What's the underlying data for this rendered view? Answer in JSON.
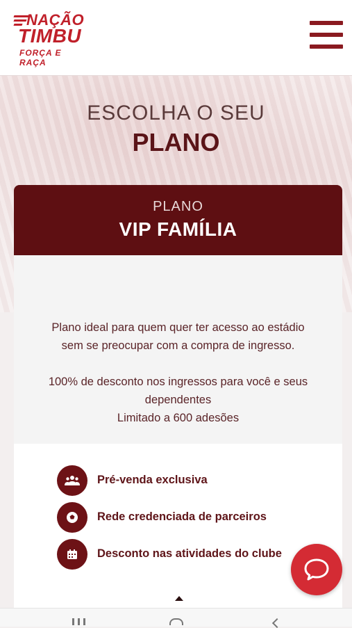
{
  "header": {
    "logo": {
      "line1": "NAÇÃO",
      "line2": "TIMBU",
      "tagline": "FORÇA E RAÇA"
    },
    "menu_icon": "hamburger-icon"
  },
  "hero": {
    "choose_label": "ESCOLHA O SEU",
    "choose_strong": "PLANO"
  },
  "plan": {
    "kicker": "PLANO",
    "name": "VIP FAMÍLIA",
    "description_line1": "Plano ideal para quem quer ter acesso ao estádio",
    "description_line2": "sem se preocupar com a compra de ingresso.",
    "discount_line1": "100% de desconto nos ingressos para você e seus",
    "discount_line2": "dependentes",
    "limit": "Limitado a 600 adesões",
    "benefits": [
      {
        "icon": "group-icon",
        "label": "Pré-venda exclusiva"
      },
      {
        "icon": "soccer-ball-icon",
        "label": "Rede credenciada de parceiros"
      },
      {
        "icon": "calendar-icon",
        "label": "Desconto nas atividades do clube"
      }
    ]
  },
  "chat_button": {
    "icon": "chat-bubble-icon"
  },
  "colors": {
    "brand_dark": "#5e0f12",
    "brand_red": "#c0202a",
    "chat_red": "#d42b34"
  }
}
